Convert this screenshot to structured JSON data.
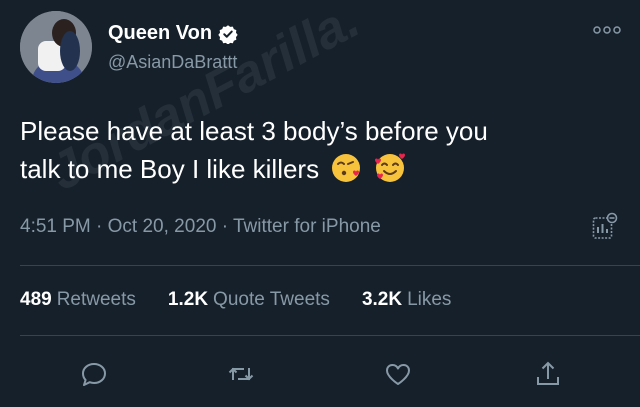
{
  "author": {
    "display_name": "Queen Von",
    "handle": "@AsianDaBrattt",
    "verified": true
  },
  "tweet": {
    "line1": "Please have at least 3 body’s before you",
    "line2": "talk to me Boy I like killers",
    "emojis": [
      "kissing-heart-emoji",
      "smiling-face-with-hearts-emoji"
    ]
  },
  "meta": {
    "time": "4:51 PM",
    "sep1": "·",
    "date": "Oct 20, 2020",
    "sep2": "·",
    "source": "Twitter for iPhone"
  },
  "stats": {
    "retweets_count": "489",
    "retweets_label": "Retweets",
    "quotes_count": "1.2K",
    "quotes_label": "Quote Tweets",
    "likes_count": "3.2K",
    "likes_label": "Likes"
  },
  "watermark": "JordanFarilla.",
  "colors": {
    "background": "#15202b",
    "secondary_text": "#8899a6",
    "divider": "#38444d",
    "primary_text": "#ffffff"
  }
}
